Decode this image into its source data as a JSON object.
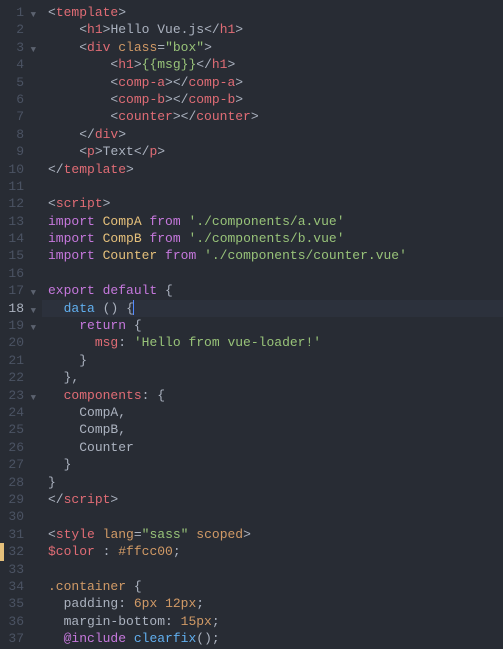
{
  "lines": [
    {
      "num": "1",
      "fold": "▼",
      "tokens": [
        {
          "c": "punc",
          "t": "<"
        },
        {
          "c": "tag",
          "t": "template"
        },
        {
          "c": "punc",
          "t": ">"
        }
      ],
      "indent": 0
    },
    {
      "num": "2",
      "tokens": [
        {
          "c": "punc",
          "t": "<"
        },
        {
          "c": "tag",
          "t": "h1"
        },
        {
          "c": "punc",
          "t": ">"
        },
        {
          "c": "text",
          "t": "Hello Vue.js"
        },
        {
          "c": "punc",
          "t": "</"
        },
        {
          "c": "tag",
          "t": "h1"
        },
        {
          "c": "punc",
          "t": ">"
        }
      ],
      "indent": 2
    },
    {
      "num": "3",
      "fold": "▼",
      "tokens": [
        {
          "c": "punc",
          "t": "<"
        },
        {
          "c": "tag",
          "t": "div"
        },
        {
          "c": "text",
          "t": " "
        },
        {
          "c": "attr",
          "t": "class"
        },
        {
          "c": "punc",
          "t": "="
        },
        {
          "c": "str",
          "t": "\"box\""
        },
        {
          "c": "punc",
          "t": ">"
        }
      ],
      "indent": 2
    },
    {
      "num": "4",
      "tokens": [
        {
          "c": "punc",
          "t": "<"
        },
        {
          "c": "tag",
          "t": "h1"
        },
        {
          "c": "punc",
          "t": ">"
        },
        {
          "c": "mustache",
          "t": "{{msg}}"
        },
        {
          "c": "punc",
          "t": "</"
        },
        {
          "c": "tag",
          "t": "h1"
        },
        {
          "c": "punc",
          "t": ">"
        }
      ],
      "indent": 4
    },
    {
      "num": "5",
      "tokens": [
        {
          "c": "punc",
          "t": "<"
        },
        {
          "c": "tag",
          "t": "comp-a"
        },
        {
          "c": "punc",
          "t": "></"
        },
        {
          "c": "tag",
          "t": "comp-a"
        },
        {
          "c": "punc",
          "t": ">"
        }
      ],
      "indent": 4
    },
    {
      "num": "6",
      "tokens": [
        {
          "c": "punc",
          "t": "<"
        },
        {
          "c": "tag",
          "t": "comp-b"
        },
        {
          "c": "punc",
          "t": "></"
        },
        {
          "c": "tag",
          "t": "comp-b"
        },
        {
          "c": "punc",
          "t": ">"
        }
      ],
      "indent": 4
    },
    {
      "num": "7",
      "tokens": [
        {
          "c": "punc",
          "t": "<"
        },
        {
          "c": "tag",
          "t": "counter"
        },
        {
          "c": "punc",
          "t": "></"
        },
        {
          "c": "tag",
          "t": "counter"
        },
        {
          "c": "punc",
          "t": ">"
        }
      ],
      "indent": 4
    },
    {
      "num": "8",
      "tokens": [
        {
          "c": "punc",
          "t": "</"
        },
        {
          "c": "tag",
          "t": "div"
        },
        {
          "c": "punc",
          "t": ">"
        }
      ],
      "indent": 2
    },
    {
      "num": "9",
      "tokens": [
        {
          "c": "punc",
          "t": "<"
        },
        {
          "c": "tag",
          "t": "p"
        },
        {
          "c": "punc",
          "t": ">"
        },
        {
          "c": "text",
          "t": "Text"
        },
        {
          "c": "punc",
          "t": "</"
        },
        {
          "c": "tag",
          "t": "p"
        },
        {
          "c": "punc",
          "t": ">"
        }
      ],
      "indent": 2
    },
    {
      "num": "10",
      "tokens": [
        {
          "c": "punc",
          "t": "</"
        },
        {
          "c": "tag",
          "t": "template"
        },
        {
          "c": "punc",
          "t": ">"
        }
      ],
      "indent": 0
    },
    {
      "num": "11",
      "tokens": [],
      "indent": 0
    },
    {
      "num": "12",
      "tokens": [
        {
          "c": "punc",
          "t": "<"
        },
        {
          "c": "tag",
          "t": "script"
        },
        {
          "c": "punc",
          "t": ">"
        }
      ],
      "indent": 0
    },
    {
      "num": "13",
      "tokens": [
        {
          "c": "kw",
          "t": "import"
        },
        {
          "c": "text",
          "t": " "
        },
        {
          "c": "ident",
          "t": "CompA"
        },
        {
          "c": "text",
          "t": " "
        },
        {
          "c": "kw",
          "t": "from"
        },
        {
          "c": "text",
          "t": " "
        },
        {
          "c": "str",
          "t": "'./components/a.vue'"
        }
      ],
      "indent": 0
    },
    {
      "num": "14",
      "tokens": [
        {
          "c": "kw",
          "t": "import"
        },
        {
          "c": "text",
          "t": " "
        },
        {
          "c": "ident",
          "t": "CompB"
        },
        {
          "c": "text",
          "t": " "
        },
        {
          "c": "kw",
          "t": "from"
        },
        {
          "c": "text",
          "t": " "
        },
        {
          "c": "str",
          "t": "'./components/b.vue'"
        }
      ],
      "indent": 0
    },
    {
      "num": "15",
      "tokens": [
        {
          "c": "kw",
          "t": "import"
        },
        {
          "c": "text",
          "t": " "
        },
        {
          "c": "ident",
          "t": "Counter"
        },
        {
          "c": "text",
          "t": " "
        },
        {
          "c": "kw",
          "t": "from"
        },
        {
          "c": "text",
          "t": " "
        },
        {
          "c": "str",
          "t": "'./components/counter.vue'"
        }
      ],
      "indent": 0
    },
    {
      "num": "16",
      "tokens": [],
      "indent": 0
    },
    {
      "num": "17",
      "fold": "▼",
      "tokens": [
        {
          "c": "kw",
          "t": "export"
        },
        {
          "c": "text",
          "t": " "
        },
        {
          "c": "kw",
          "t": "default"
        },
        {
          "c": "text",
          "t": " "
        },
        {
          "c": "punc",
          "t": "{"
        }
      ],
      "indent": 0
    },
    {
      "num": "18",
      "fold": "▼",
      "active": true,
      "cursor": true,
      "tokens": [
        {
          "c": "fn",
          "t": "data"
        },
        {
          "c": "text",
          "t": " "
        },
        {
          "c": "punc",
          "t": "()"
        },
        {
          "c": "text",
          "t": " "
        },
        {
          "c": "punc",
          "t": "{"
        }
      ],
      "indent": 1
    },
    {
      "num": "19",
      "fold": "▼",
      "tokens": [
        {
          "c": "kw",
          "t": "return"
        },
        {
          "c": "text",
          "t": " "
        },
        {
          "c": "punc",
          "t": "{"
        }
      ],
      "indent": 2
    },
    {
      "num": "20",
      "tokens": [
        {
          "c": "prop",
          "t": "msg"
        },
        {
          "c": "punc",
          "t": ":"
        },
        {
          "c": "text",
          "t": " "
        },
        {
          "c": "str",
          "t": "'Hello from vue-loader!'"
        }
      ],
      "indent": 3
    },
    {
      "num": "21",
      "tokens": [
        {
          "c": "punc",
          "t": "}"
        }
      ],
      "indent": 2
    },
    {
      "num": "22",
      "tokens": [
        {
          "c": "punc",
          "t": "},"
        }
      ],
      "indent": 1
    },
    {
      "num": "23",
      "fold": "▼",
      "tokens": [
        {
          "c": "prop",
          "t": "components"
        },
        {
          "c": "punc",
          "t": ":"
        },
        {
          "c": "text",
          "t": " "
        },
        {
          "c": "punc",
          "t": "{"
        }
      ],
      "indent": 1
    },
    {
      "num": "24",
      "tokens": [
        {
          "c": "text",
          "t": "CompA,"
        }
      ],
      "indent": 2
    },
    {
      "num": "25",
      "tokens": [
        {
          "c": "text",
          "t": "CompB,"
        }
      ],
      "indent": 2
    },
    {
      "num": "26",
      "tokens": [
        {
          "c": "text",
          "t": "Counter"
        }
      ],
      "indent": 2
    },
    {
      "num": "27",
      "tokens": [
        {
          "c": "punc",
          "t": "}"
        }
      ],
      "indent": 1
    },
    {
      "num": "28",
      "tokens": [
        {
          "c": "punc",
          "t": "}"
        }
      ],
      "indent": 0
    },
    {
      "num": "29",
      "tokens": [
        {
          "c": "punc",
          "t": "</"
        },
        {
          "c": "tag",
          "t": "script"
        },
        {
          "c": "punc",
          "t": ">"
        }
      ],
      "indent": 0
    },
    {
      "num": "30",
      "tokens": [],
      "indent": 0
    },
    {
      "num": "31",
      "tokens": [
        {
          "c": "punc",
          "t": "<"
        },
        {
          "c": "tag",
          "t": "style"
        },
        {
          "c": "text",
          "t": " "
        },
        {
          "c": "attr",
          "t": "lang"
        },
        {
          "c": "punc",
          "t": "="
        },
        {
          "c": "str",
          "t": "\"sass\""
        },
        {
          "c": "text",
          "t": " "
        },
        {
          "c": "attr",
          "t": "scoped"
        },
        {
          "c": "punc",
          "t": ">"
        }
      ],
      "indent": 0
    },
    {
      "num": "32",
      "mod": true,
      "tokens": [
        {
          "c": "var",
          "t": "$color"
        },
        {
          "c": "text",
          "t": " "
        },
        {
          "c": "punc",
          "t": ":"
        },
        {
          "c": "text",
          "t": " "
        },
        {
          "c": "num",
          "t": "#ffcc00"
        },
        {
          "c": "punc",
          "t": ";"
        }
      ],
      "indent": 0
    },
    {
      "num": "33",
      "tokens": [],
      "indent": 0
    },
    {
      "num": "34",
      "tokens": [
        {
          "c": "attr",
          "t": ".container"
        },
        {
          "c": "text",
          "t": " "
        },
        {
          "c": "punc",
          "t": "{"
        }
      ],
      "indent": 0
    },
    {
      "num": "35",
      "tokens": [
        {
          "c": "text",
          "t": "padding"
        },
        {
          "c": "punc",
          "t": ":"
        },
        {
          "c": "text",
          "t": " "
        },
        {
          "c": "num",
          "t": "6px"
        },
        {
          "c": "text",
          "t": " "
        },
        {
          "c": "num",
          "t": "12px"
        },
        {
          "c": "punc",
          "t": ";"
        }
      ],
      "indent": 1
    },
    {
      "num": "36",
      "tokens": [
        {
          "c": "text",
          "t": "margin-bottom"
        },
        {
          "c": "punc",
          "t": ":"
        },
        {
          "c": "text",
          "t": " "
        },
        {
          "c": "num",
          "t": "15px"
        },
        {
          "c": "punc",
          "t": ";"
        }
      ],
      "indent": 1
    },
    {
      "num": "37",
      "tokens": [
        {
          "c": "kw",
          "t": "@include"
        },
        {
          "c": "text",
          "t": " "
        },
        {
          "c": "fn",
          "t": "clearfix"
        },
        {
          "c": "punc",
          "t": "();"
        }
      ],
      "indent": 1
    }
  ],
  "indent_unit": "  "
}
